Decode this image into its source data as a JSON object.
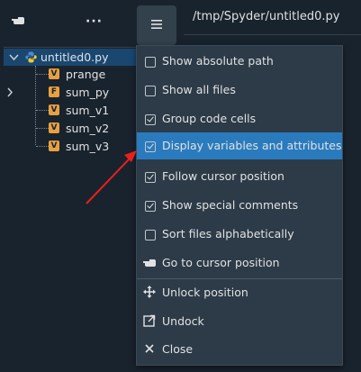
{
  "toolbar": {
    "hand_icon": "hand-pointer-icon",
    "dots_label": "···"
  },
  "tree": {
    "root": {
      "label": "untitled0.py",
      "icon": "python-file-icon"
    },
    "children": [
      {
        "badge": "V",
        "label": "prange",
        "expandable": false
      },
      {
        "badge": "F",
        "label": "sum_py",
        "expandable": true
      },
      {
        "badge": "V",
        "label": "sum_v1",
        "expandable": false
      },
      {
        "badge": "V",
        "label": "sum_v2",
        "expandable": false
      },
      {
        "badge": "V",
        "label": "sum_v3",
        "expandable": false
      }
    ]
  },
  "editor": {
    "path": "/tmp/Spyder/untitled0.py"
  },
  "menu": {
    "items": [
      {
        "label": "Show absolute path",
        "type": "checkbox",
        "checked": false
      },
      {
        "label": "Show all files",
        "type": "checkbox",
        "checked": false
      },
      {
        "label": "Group code cells",
        "type": "checkbox",
        "checked": true
      },
      {
        "label": "Display variables and attributes",
        "type": "checkbox",
        "checked": true,
        "highlighted": true
      },
      {
        "label": "Follow cursor position",
        "type": "checkbox",
        "checked": true
      },
      {
        "label": "Show special comments",
        "type": "checkbox",
        "checked": true
      },
      {
        "label": "Sort files alphabetically",
        "type": "checkbox",
        "checked": false
      },
      {
        "label": "Go to cursor position",
        "type": "action",
        "icon": "hand-pointer-icon"
      },
      {
        "label": "Unlock position",
        "type": "action",
        "icon": "move-arrows-icon"
      },
      {
        "label": "Undock",
        "type": "action",
        "icon": "undock-icon"
      },
      {
        "label": "Close",
        "type": "action",
        "icon": "close-icon"
      }
    ]
  },
  "colors": {
    "background": "#19232d",
    "menu_bg": "#2c3b47",
    "highlight": "#2a7bbd",
    "badge_orange": "#e8a040",
    "annotation_arrow": "#e8201c"
  }
}
